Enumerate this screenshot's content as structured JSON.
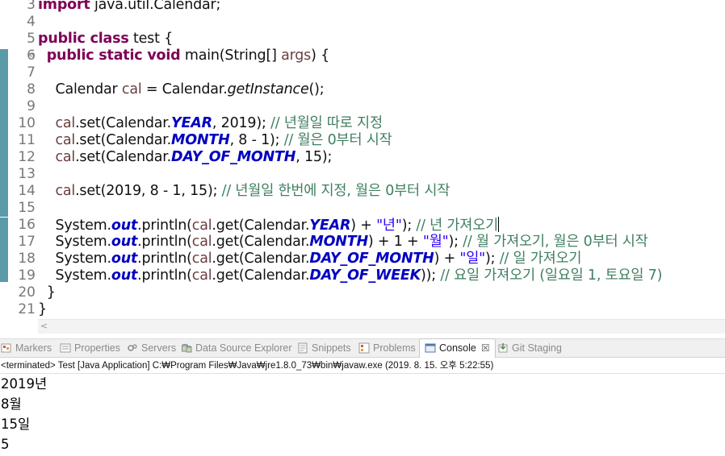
{
  "editor": {
    "lines": [
      {
        "n": "3",
        "fold": "",
        "segments": [
          {
            "c": "kw",
            "t": "import"
          },
          {
            "c": "",
            "t": " java.util.Calendar;"
          }
        ]
      },
      {
        "n": "4",
        "fold": "",
        "segments": []
      },
      {
        "n": "5",
        "fold": "",
        "segments": [
          {
            "c": "kw",
            "t": "public class"
          },
          {
            "c": "",
            "t": " test {"
          }
        ]
      },
      {
        "n": "6",
        "fold": "⊖",
        "segments": [
          {
            "c": "",
            "t": "  "
          },
          {
            "c": "kw",
            "t": "public static void"
          },
          {
            "c": "",
            "t": " main(String[] "
          },
          {
            "c": "lv",
            "t": "args"
          },
          {
            "c": "",
            "t": ") {"
          }
        ]
      },
      {
        "n": "7",
        "fold": "",
        "segments": []
      },
      {
        "n": "8",
        "fold": "",
        "segments": [
          {
            "c": "",
            "t": "    Calendar "
          },
          {
            "c": "lv",
            "t": "cal"
          },
          {
            "c": "",
            "t": " = Calendar."
          },
          {
            "c": "smeth",
            "t": "getInstance"
          },
          {
            "c": "",
            "t": "();"
          }
        ]
      },
      {
        "n": "9",
        "fold": "",
        "segments": []
      },
      {
        "n": "10",
        "fold": "",
        "segments": [
          {
            "c": "",
            "t": "    "
          },
          {
            "c": "lv",
            "t": "cal"
          },
          {
            "c": "",
            "t": ".set(Calendar."
          },
          {
            "c": "fld",
            "t": "YEAR"
          },
          {
            "c": "",
            "t": ", 2019); "
          },
          {
            "c": "cm",
            "t": "// 년월일 따로 지정"
          }
        ]
      },
      {
        "n": "11",
        "fold": "",
        "segments": [
          {
            "c": "",
            "t": "    "
          },
          {
            "c": "lv",
            "t": "cal"
          },
          {
            "c": "",
            "t": ".set(Calendar."
          },
          {
            "c": "fld",
            "t": "MONTH"
          },
          {
            "c": "",
            "t": ", 8 - 1); "
          },
          {
            "c": "cm",
            "t": "// 월은 0부터 시작"
          }
        ]
      },
      {
        "n": "12",
        "fold": "",
        "segments": [
          {
            "c": "",
            "t": "    "
          },
          {
            "c": "lv",
            "t": "cal"
          },
          {
            "c": "",
            "t": ".set(Calendar."
          },
          {
            "c": "fld",
            "t": "DAY_OF_MONTH"
          },
          {
            "c": "",
            "t": ", 15);"
          }
        ]
      },
      {
        "n": "13",
        "fold": "",
        "segments": []
      },
      {
        "n": "14",
        "fold": "",
        "segments": [
          {
            "c": "",
            "t": "    "
          },
          {
            "c": "lv",
            "t": "cal"
          },
          {
            "c": "",
            "t": ".set(2019, 8 - 1, 15); "
          },
          {
            "c": "cm",
            "t": "// 년월일 한번에 지정, 월은 0부터 시작"
          }
        ]
      },
      {
        "n": "15",
        "fold": "",
        "segments": []
      },
      {
        "n": "16",
        "fold": "",
        "caret": true,
        "segments": [
          {
            "c": "",
            "t": "    System."
          },
          {
            "c": "fld",
            "t": "out"
          },
          {
            "c": "",
            "t": ".println("
          },
          {
            "c": "lv",
            "t": "cal"
          },
          {
            "c": "",
            "t": ".get(Calendar."
          },
          {
            "c": "fld",
            "t": "YEAR"
          },
          {
            "c": "",
            "t": ") + "
          },
          {
            "c": "str",
            "t": "\"년\""
          },
          {
            "c": "",
            "t": "); "
          },
          {
            "c": "cm",
            "t": "// 년 가져오기"
          }
        ]
      },
      {
        "n": "17",
        "fold": "",
        "segments": [
          {
            "c": "",
            "t": "    System."
          },
          {
            "c": "fld",
            "t": "out"
          },
          {
            "c": "",
            "t": ".println("
          },
          {
            "c": "lv",
            "t": "cal"
          },
          {
            "c": "",
            "t": ".get(Calendar."
          },
          {
            "c": "fld",
            "t": "MONTH"
          },
          {
            "c": "",
            "t": ") + 1 + "
          },
          {
            "c": "str",
            "t": "\"월\""
          },
          {
            "c": "",
            "t": "); "
          },
          {
            "c": "cm",
            "t": "// 월 가져오기, 월은 0부터 시작"
          }
        ]
      },
      {
        "n": "18",
        "fold": "",
        "segments": [
          {
            "c": "",
            "t": "    System."
          },
          {
            "c": "fld",
            "t": "out"
          },
          {
            "c": "",
            "t": ".println("
          },
          {
            "c": "lv",
            "t": "cal"
          },
          {
            "c": "",
            "t": ".get(Calendar."
          },
          {
            "c": "fld",
            "t": "DAY_OF_MONTH"
          },
          {
            "c": "",
            "t": ") + "
          },
          {
            "c": "str",
            "t": "\"일\""
          },
          {
            "c": "",
            "t": "); "
          },
          {
            "c": "cm",
            "t": "// 일 가져오기"
          }
        ]
      },
      {
        "n": "19",
        "fold": "",
        "segments": [
          {
            "c": "",
            "t": "    System."
          },
          {
            "c": "fld",
            "t": "out"
          },
          {
            "c": "",
            "t": ".println("
          },
          {
            "c": "lv",
            "t": "cal"
          },
          {
            "c": "",
            "t": ".get(Calendar."
          },
          {
            "c": "fld",
            "t": "DAY_OF_WEEK"
          },
          {
            "c": "",
            "t": ")); "
          },
          {
            "c": "cm",
            "t": "// 요일 가져오기 (일요일 1, 토요일 7)"
          }
        ]
      },
      {
        "n": "20",
        "fold": "",
        "segments": [
          {
            "c": "",
            "t": "  }"
          }
        ]
      },
      {
        "n": "21",
        "fold": "",
        "segments": [
          {
            "c": "",
            "t": "}"
          }
        ]
      }
    ],
    "scroll_arrow": "<"
  },
  "tabs": [
    {
      "label": "Markers",
      "icon": "markers-icon",
      "active": false
    },
    {
      "label": "Properties",
      "icon": "properties-icon",
      "active": false
    },
    {
      "label": "Servers",
      "icon": "servers-icon",
      "active": false
    },
    {
      "label": "Data Source Explorer",
      "icon": "data-source-explorer-icon",
      "active": false
    },
    {
      "label": "Snippets",
      "icon": "snippets-icon",
      "active": false
    },
    {
      "label": "Problems",
      "icon": "problems-icon",
      "active": false
    },
    {
      "label": "Console",
      "icon": "console-icon",
      "active": true,
      "close": "☒"
    },
    {
      "label": "Git Staging",
      "icon": "git-staging-icon",
      "active": false
    }
  ],
  "console": {
    "header": "<terminated> Test [Java Application] C:₩Program Files₩Java₩jre1.8.0_73₩bin₩javaw.exe (2019. 8. 15. 오후 5:22:55)",
    "output": [
      "2019년",
      "8월",
      "15일",
      "5"
    ]
  },
  "colors": {
    "keyword": "#7f0055",
    "comment": "#3f7f5f",
    "string": "#2a00ff",
    "field": "#0000c0",
    "local_var": "#6a3e3e",
    "change_ruler": "#5b9aa9"
  }
}
